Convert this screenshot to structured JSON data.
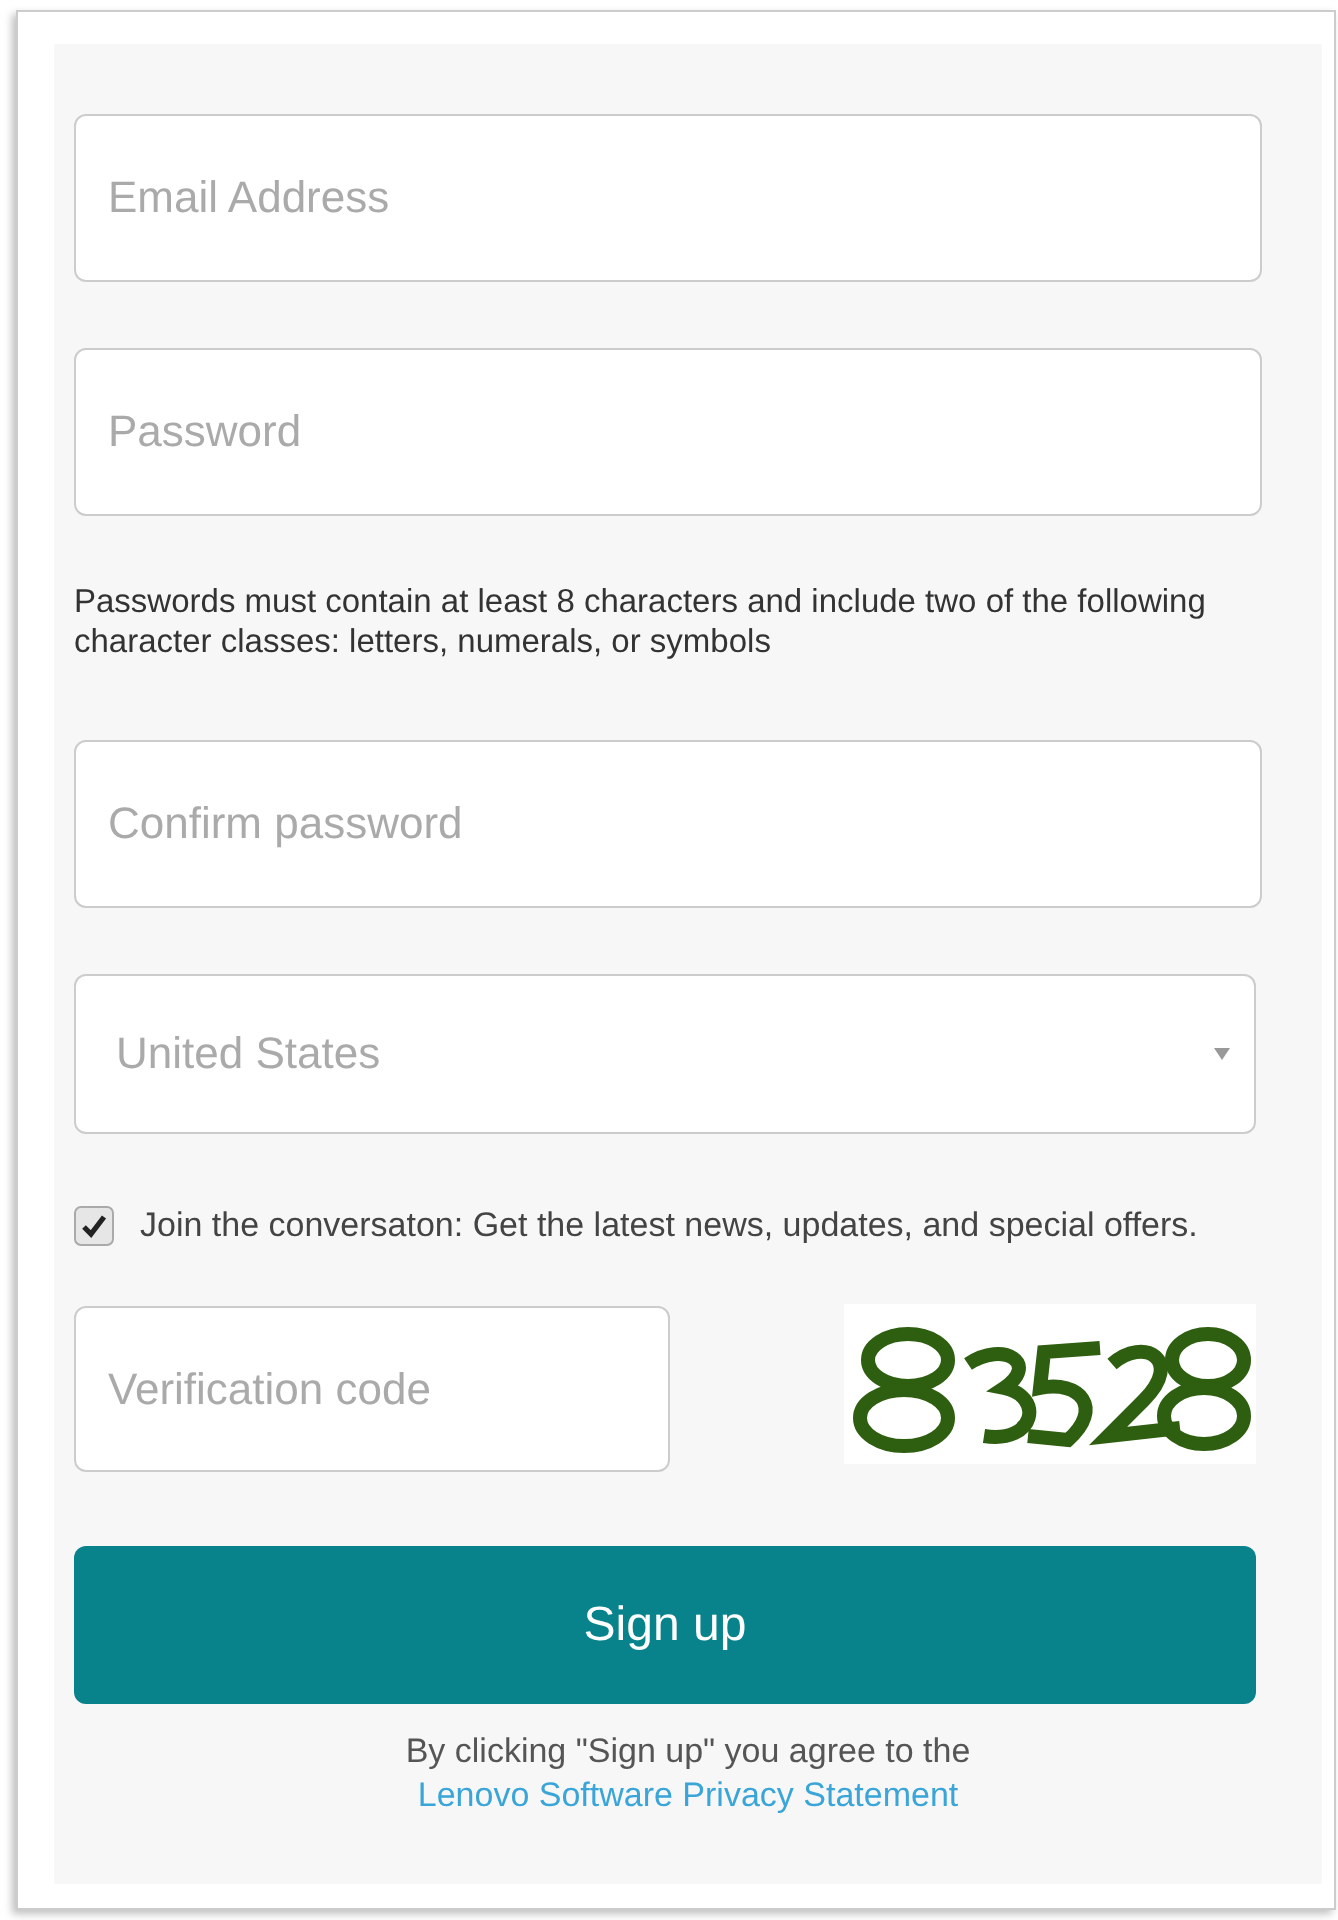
{
  "fields": [
    {
      "placeholder": "Email Address"
    },
    {
      "placeholder": "Password"
    }
  ],
  "password_hint": "Passwords must contain at least 8 characters and include two of the following character classes: letters, numerals, or symbols",
  "confirm_field": {
    "placeholder": "Confirm password"
  },
  "country_select": {
    "value": "United States"
  },
  "newsletter": {
    "label": "Join the conversaton: Get the latest news, updates, and special offers.",
    "checked": true
  },
  "verification": {
    "placeholder": "Verification code"
  },
  "signup_button": "Sign up",
  "agreement": {
    "text": "By clicking \"Sign up\" you agree to the",
    "link": "Lenovo Software Privacy Statement"
  }
}
